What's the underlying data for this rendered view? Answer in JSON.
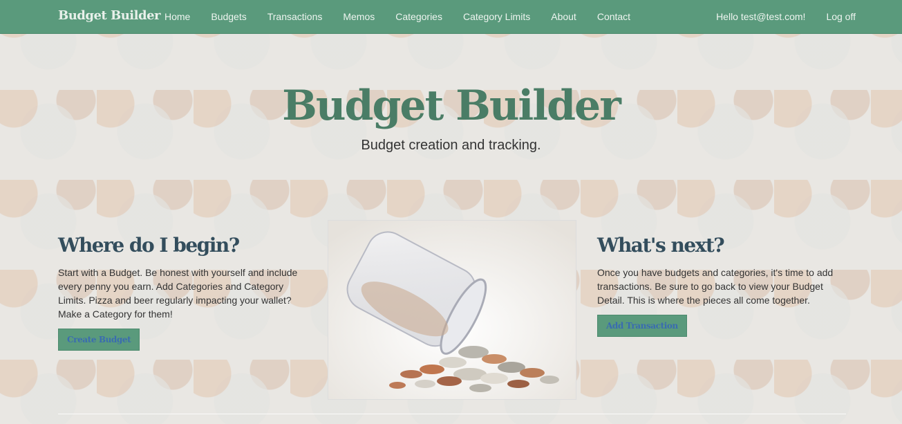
{
  "navbar": {
    "brand": "Budget Builder",
    "links": [
      "Home",
      "Budgets",
      "Transactions",
      "Memos",
      "Categories",
      "Category Limits",
      "About",
      "Contact"
    ],
    "greeting": "Hello test@test.com!",
    "logoff": "Log off"
  },
  "hero": {
    "title": "Budget Builder",
    "subtitle": "Budget creation and tracking."
  },
  "left": {
    "heading": "Where do I begin?",
    "text": "Start with a Budget. Be honest with yourself and include every penny you earn. Add Categories and Category Limits. Pizza and beer regularly impacting your wallet? Make a Category for them!",
    "button": "Create Budget"
  },
  "right": {
    "heading": "What's next?",
    "text": "Once you have budgets and categories, it's time to add transactions. Be sure to go back to view your Budget Detail. This is where the pieces all come together.",
    "button": "Add Transaction"
  },
  "image": {
    "icon": "coin-jar-image"
  },
  "colors": {
    "navbar": "#5a9a7c",
    "hero_title": "#4a7d66",
    "heading": "#334d5c",
    "button_text": "#3a6cb0"
  }
}
